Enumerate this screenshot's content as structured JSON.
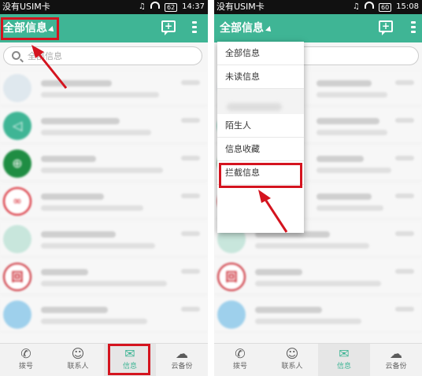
{
  "left": {
    "status": {
      "carrier": "没有USIM卡",
      "time": "14:37",
      "battery": "62"
    },
    "header": {
      "title": "全部信息"
    },
    "search": {
      "placeholder": "全部信息"
    },
    "nav": [
      {
        "label": "拨号",
        "icon": "phone-icon"
      },
      {
        "label": "联系人",
        "icon": "contacts-icon"
      },
      {
        "label": "信息",
        "icon": "messages-icon"
      },
      {
        "label": "云备份",
        "icon": "cloud-icon"
      }
    ],
    "active_nav": "信息"
  },
  "right": {
    "status": {
      "carrier": "没有USIM卡",
      "time": "15:08",
      "battery": "60"
    },
    "header": {
      "title": "全部信息"
    },
    "dropdown": {
      "items": [
        "全部信息",
        "未读信息",
        "陌生人",
        "信息收藏",
        "拦截信息"
      ],
      "highlighted": "拦截信息"
    },
    "nav": [
      {
        "label": "拨号",
        "icon": "phone-icon"
      },
      {
        "label": "联系人",
        "icon": "contacts-icon"
      },
      {
        "label": "信息",
        "icon": "messages-icon"
      },
      {
        "label": "云备份",
        "icon": "cloud-icon"
      }
    ],
    "active_nav": "信息"
  },
  "colors": {
    "accent": "#3fb595",
    "highlight": "#d4141f"
  }
}
